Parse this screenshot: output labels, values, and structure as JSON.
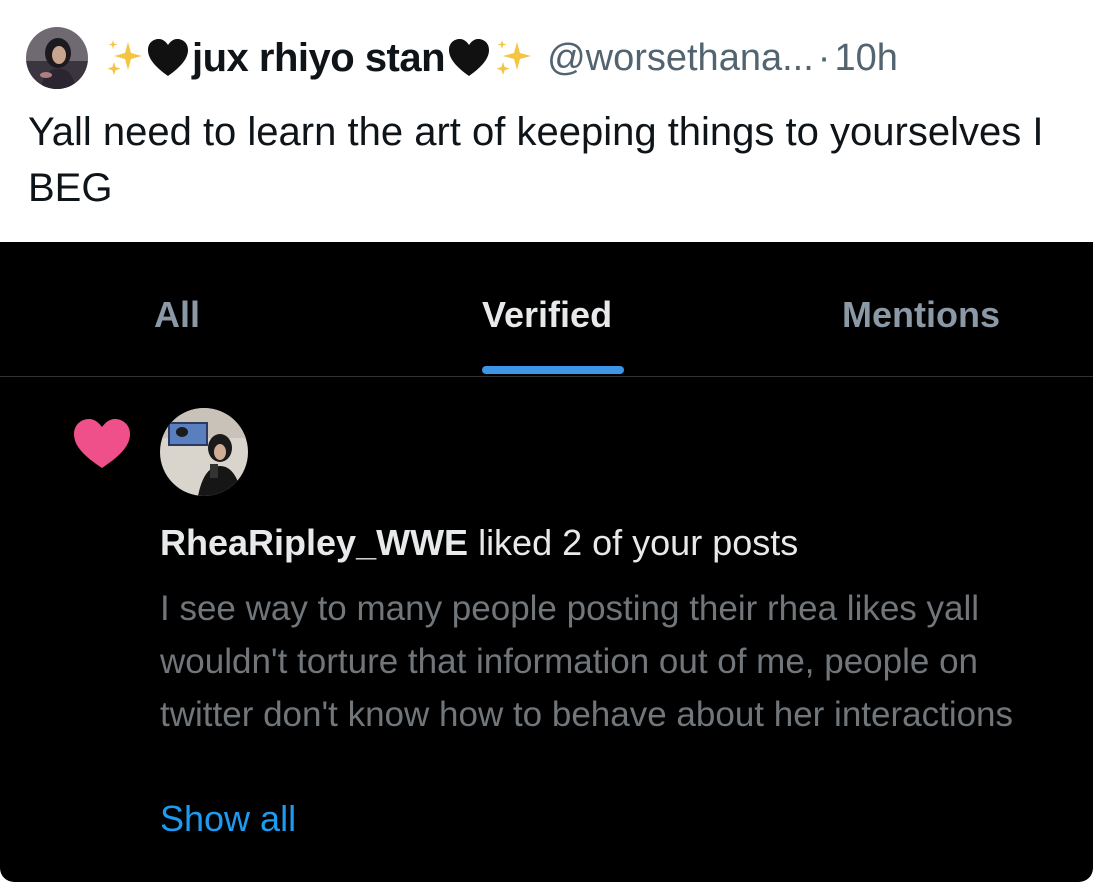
{
  "tweet": {
    "display_name": "jux rhiyo stan",
    "name_emojis": [
      "sparkles-icon",
      "black-heart-icon",
      "black-heart-icon",
      "sparkles-icon"
    ],
    "handle": "@worsethana...",
    "separator": "·",
    "time": "10h",
    "text": "Yall need to learn the art of keeping things to yourselves I BEG"
  },
  "embedded_screenshot": {
    "tabs": [
      {
        "label": "All",
        "active": false
      },
      {
        "label": "Verified",
        "active": true
      },
      {
        "label": "Mentions",
        "active": false
      }
    ],
    "notification": {
      "icon": "heart-icon",
      "username": "RheaRipley_WWE",
      "action": " liked 2 of your posts",
      "body": "I see way to many people posting their rhea likes yall wouldn't torture that information out of me, people on twitter don't know how to behave about her interactions",
      "show_all": "Show all"
    }
  },
  "colors": {
    "heart": "#f0508a",
    "link": "#1d9bf0",
    "tab_indicator": "#3d95e6",
    "muted_text": "#71767b",
    "embed_background": "#000000"
  }
}
